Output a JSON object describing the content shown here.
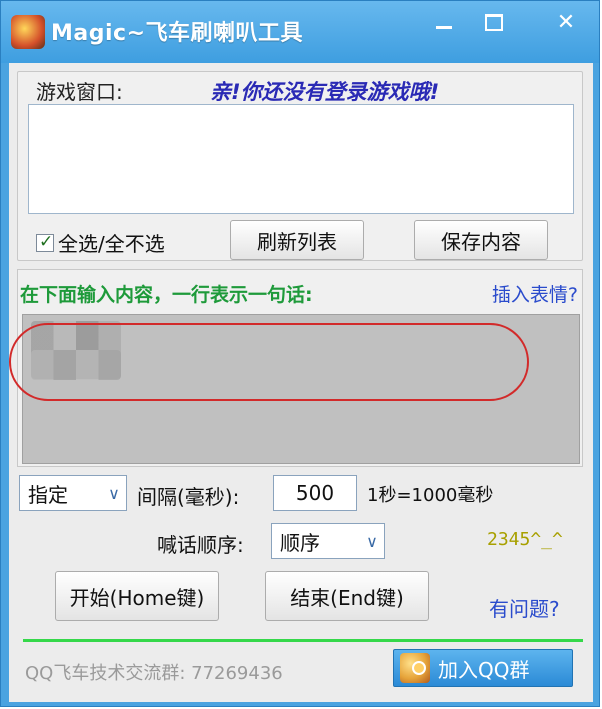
{
  "window": {
    "title": "Magic~飞车刷喇叭工具",
    "minimize_label": "─",
    "maximize_label": "□",
    "close_label": "✕"
  },
  "game_section": {
    "label": "游戏窗口:",
    "notice": "亲!你还没有登录游戏哦!",
    "select_all_label": "全选/全不选",
    "select_all_checked": true,
    "refresh_button": "刷新列表",
    "save_button": "保存内容"
  },
  "content_section": {
    "hint": "在下面输入内容，一行表示一句话:",
    "insert_emoji_link": "插入表情?"
  },
  "controls": {
    "mode_select": "指定",
    "interval_label": "间隔(毫秒):",
    "interval_value": "500",
    "interval_note": "1秒=1000毫秒",
    "order_label": "喊话顺序:",
    "order_select": "顺序",
    "credit": "2345^_^",
    "start_button": "开始(Home键)",
    "stop_button": "结束(End键)",
    "help_link": "有问题?"
  },
  "footer": {
    "qq_group_text": "QQ飞车技术交流群: 77269436",
    "join_button": "加入QQ群"
  }
}
